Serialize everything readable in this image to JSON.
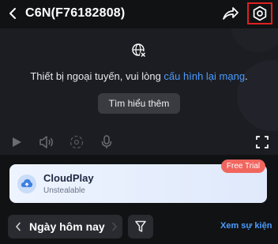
{
  "header": {
    "title": "C6N(F76182808)"
  },
  "player": {
    "offline_text": "Thiết bị ngoại tuyến, vui lòng ",
    "offline_link": "cấu hình lại mạng",
    "offline_tail": ".",
    "learn_more_label": "Tìm hiểu thêm"
  },
  "cloudplay": {
    "title": "CloudPlay",
    "subtitle": "Unstealable",
    "badge": "Free Trial"
  },
  "events": {
    "date_label": "Ngày hôm nay",
    "view_events_label": "Xem sự kiện"
  },
  "colors": {
    "accent": "#4a9cff",
    "highlight": "#e02020",
    "badge": "#f0665f"
  }
}
